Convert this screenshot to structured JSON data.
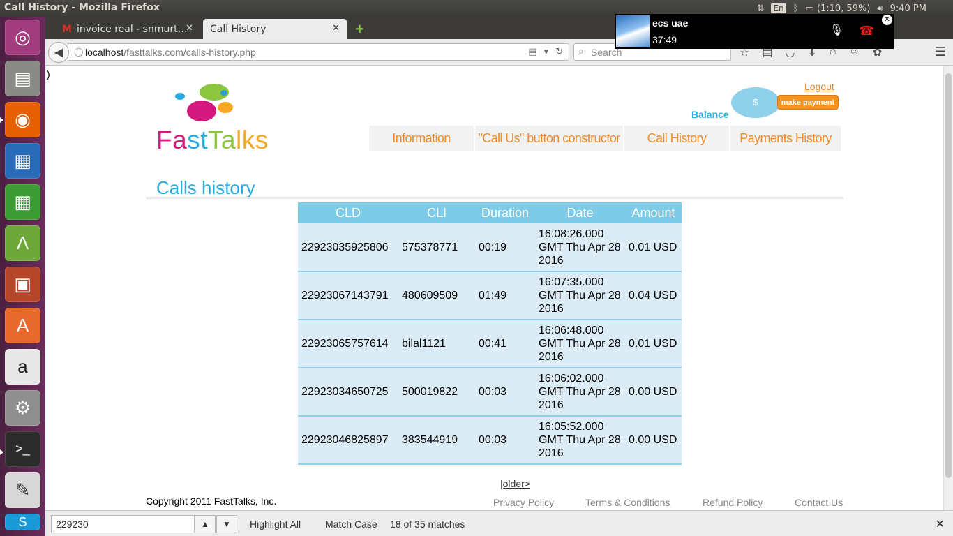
{
  "window_title": "Call History - Mozilla Firefox",
  "indicators": {
    "keyboard": "En",
    "battery": "(1:10, 59%)",
    "clock": "9:40 PM"
  },
  "tabs": [
    {
      "label": "invoice real - snmurt…",
      "active": false
    },
    {
      "label": "Call History",
      "active": true
    }
  ],
  "url": {
    "host": "localhost",
    "path": "/fasttalks.com/calls-history.php"
  },
  "search_placeholder": "Search",
  "call_popup": {
    "name": "ecs uae",
    "duration": "37:49"
  },
  "page": {
    "stray_text": ")",
    "logo_word": [
      "F",
      "a",
      "s",
      "t",
      "T",
      "a",
      "l",
      "k",
      "s"
    ],
    "logo_colors": [
      "#d6197f",
      "#d6197f",
      "#29abe2",
      "#29abe2",
      "#8cc63f",
      "#8cc63f",
      "#f7a823",
      "#f7a823",
      "#f7a823"
    ],
    "logout": "Logout",
    "balance_label": "Balance",
    "balance_symbol": "$",
    "make_payment": "make payment",
    "nav": [
      {
        "label": "Information"
      },
      {
        "label": "\"Call Us\" button constructor"
      },
      {
        "label": "Call History"
      },
      {
        "label": "Payments History"
      }
    ],
    "section_title": "Calls history",
    "table": {
      "headers": [
        "CLD",
        "CLI",
        "Duration",
        "Date",
        "Amount"
      ],
      "rows": [
        [
          "22923035925806",
          "575378771",
          "00:19",
          "16:08:26.000 GMT Thu Apr 28 2016",
          "0.01 USD"
        ],
        [
          "22923067143791",
          "480609509",
          "01:49",
          "16:07:35.000 GMT Thu Apr 28 2016",
          "0.04 USD"
        ],
        [
          "22923065757614",
          "bilal1121",
          "00:41",
          "16:06:48.000 GMT Thu Apr 28 2016",
          "0.01 USD"
        ],
        [
          "22923034650725",
          "500019822",
          "00:03",
          "16:06:02.000 GMT Thu Apr 28 2016",
          "0.00 USD"
        ],
        [
          "22923046825897",
          "383544919",
          "00:03",
          "16:05:52.000 GMT Thu Apr 28 2016",
          "0.00 USD"
        ]
      ]
    },
    "older_link": "|older>",
    "copyright": "Copyright 2011 FastTalks, Inc.",
    "footer_links": [
      "Privacy Policy",
      "Terms & Conditions",
      "Refund Policy",
      "Contact Us"
    ]
  },
  "findbar": {
    "query": "229230",
    "highlight_all": "Highlight All",
    "match_case": "Match Case",
    "status": "18 of 35 matches"
  }
}
